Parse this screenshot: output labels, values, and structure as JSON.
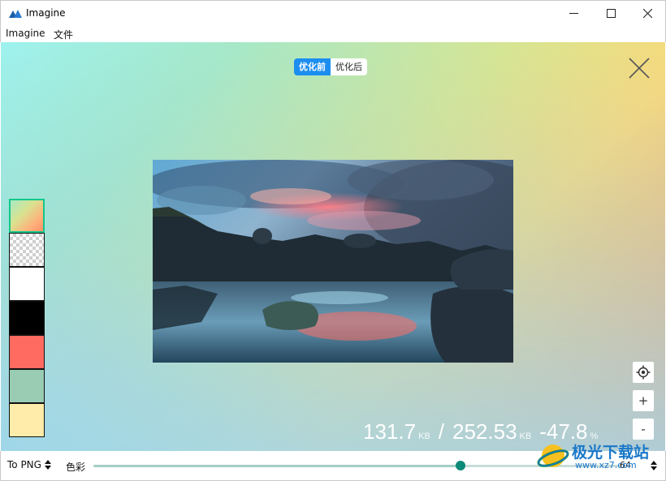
{
  "window": {
    "title": "Imagine",
    "icon": "mountain-icon",
    "controls": [
      "minimize-icon",
      "maximize-icon",
      "close-icon"
    ]
  },
  "menu": {
    "items": [
      "Imagine",
      "文件"
    ]
  },
  "compare_toggle": {
    "before_label": "优化前",
    "after_label": "优化后",
    "selected": "优化前",
    "accent_color": "#1c8ef0"
  },
  "preview": {
    "description_icon": "landscape-photo",
    "close_icon": "close-icon"
  },
  "backgrounds": {
    "items": [
      {
        "name": "gradient",
        "color": "gradient"
      },
      {
        "name": "transparent",
        "color": "checkerboard"
      },
      {
        "name": "white",
        "color": "#ffffff"
      },
      {
        "name": "black",
        "color": "#000000"
      },
      {
        "name": "red",
        "color": "#ff6b61"
      },
      {
        "name": "green",
        "color": "#99ccb2"
      },
      {
        "name": "yellow",
        "color": "#ffecaa"
      }
    ],
    "selected_index": 0,
    "selected_border_color": "#12c88b"
  },
  "view_tools": {
    "locate_icon": "crosshair-icon",
    "zoom_in_label": "+",
    "zoom_out_label": "-"
  },
  "stats": {
    "optimized_size": "131.7",
    "optimized_unit": "KB",
    "separator": "/",
    "original_size": "252.53",
    "original_unit": "KB",
    "change": "-47.8",
    "change_unit": "%"
  },
  "bottom_bar": {
    "format": "To PNG",
    "color_label": "色彩",
    "quality_value": "64",
    "slider_fraction": 0.696,
    "slider_color": "#0e8a79"
  },
  "watermark": {
    "title": "极光下载站",
    "url": "www.xz7.com"
  }
}
